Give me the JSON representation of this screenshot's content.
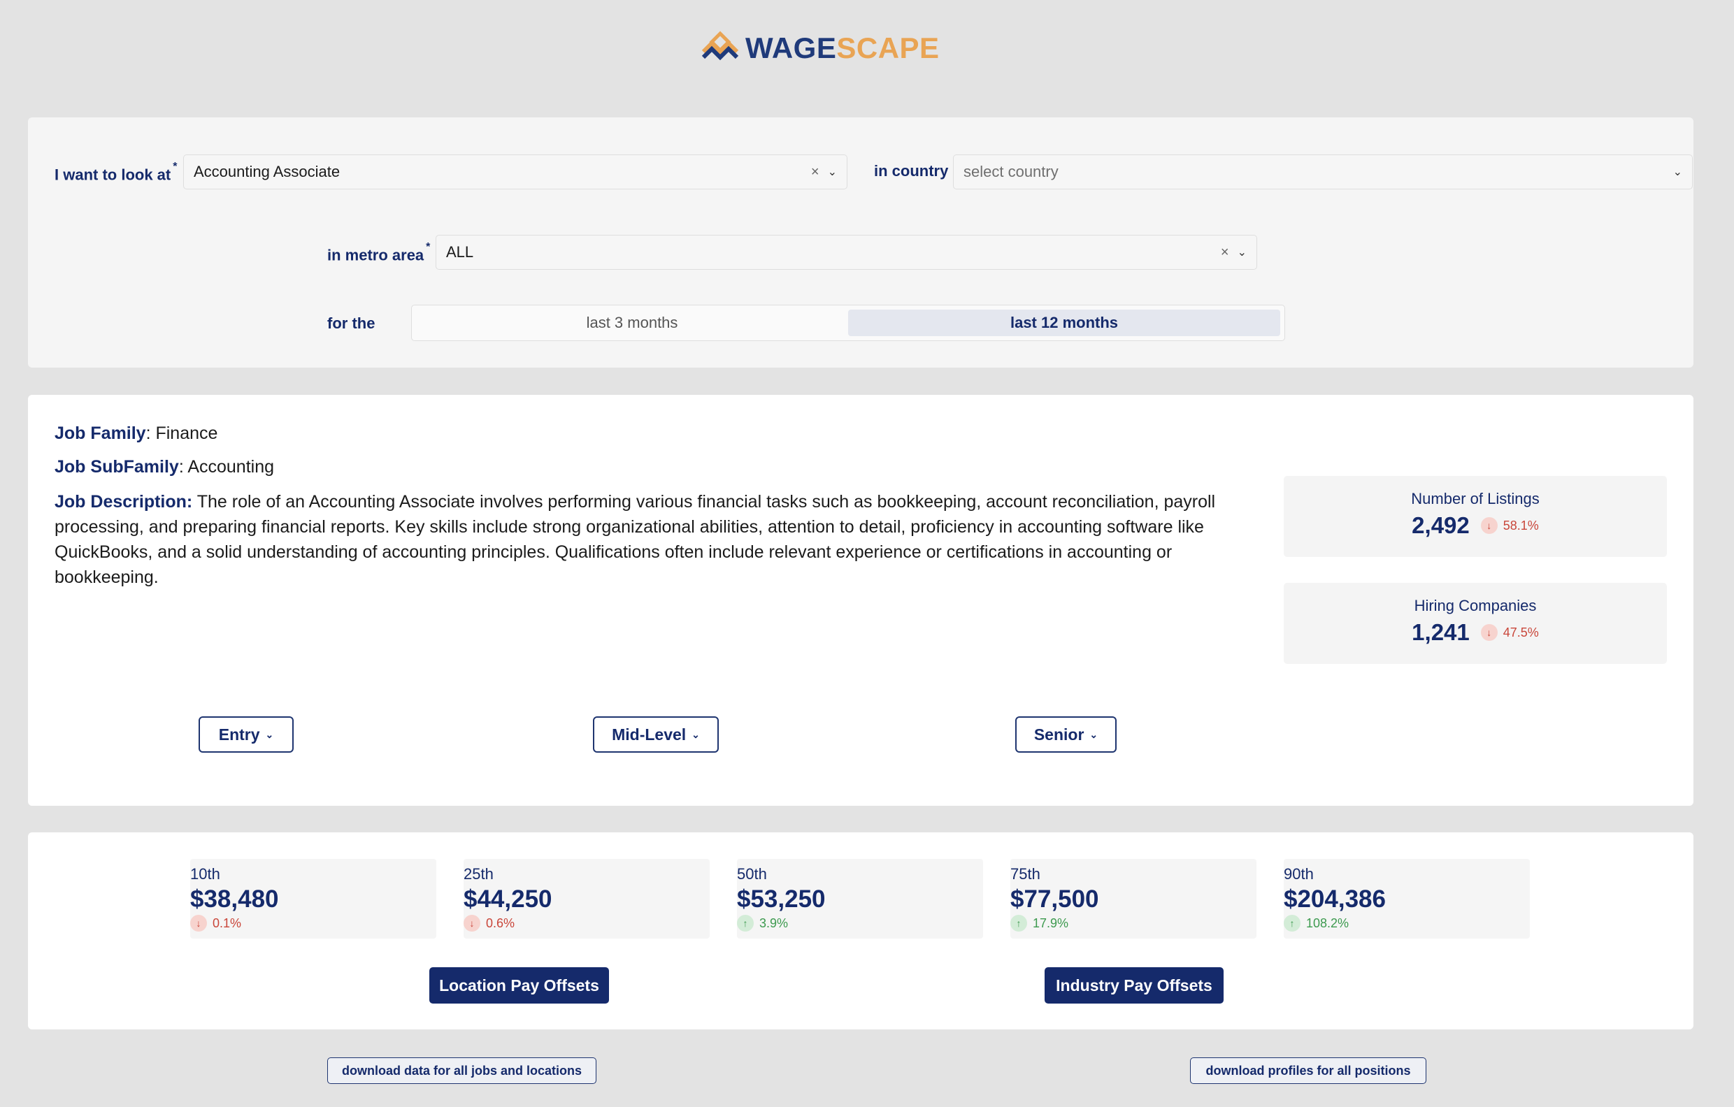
{
  "brand": {
    "name_part1": "WAGE",
    "name_part2": "SCAPE",
    "color_dark": "#1f3a7a",
    "color_accent": "#e9a454"
  },
  "filters": {
    "job_label": "I want to look at",
    "job_value": "Accounting Associate",
    "country_label": "in country",
    "country_placeholder": "select country",
    "metro_label": "in metro area",
    "metro_value": "ALL",
    "period_label": "for the",
    "periods": [
      {
        "label": "last 3 months",
        "active": false
      },
      {
        "label": "last 12 months",
        "active": true
      }
    ],
    "required_mark": "*",
    "clear_icon": "×",
    "dropdown_icon": "chevron-down-icon"
  },
  "job": {
    "family_label": "Job Family",
    "family_value": ": Finance",
    "subfamily_label": "Job SubFamily",
    "subfamily_value": ": Accounting",
    "description_label": "Job Description:",
    "description": "The role of an Accounting Associate involves performing various financial tasks such as bookkeeping, account reconciliation, payroll processing, and preparing financial reports. Key skills include strong organizational abilities, attention to detail, proficiency in accounting software like QuickBooks, and a solid understanding of accounting principles. Qualifications often include relevant experience or certifications in accounting or bookkeeping.",
    "metrics": [
      {
        "label": "Number of Listings",
        "value": "2,492",
        "change": "58.1%",
        "direction": "down"
      },
      {
        "label": "Hiring Companies",
        "value": "1,241",
        "change": "47.5%",
        "direction": "down"
      }
    ],
    "levels": [
      "Entry",
      "Mid-Level",
      "Senior"
    ]
  },
  "pay": {
    "percentiles": [
      {
        "label": "10th",
        "value": "$38,480",
        "change": "0.1%",
        "direction": "down"
      },
      {
        "label": "25th",
        "value": "$44,250",
        "change": "0.6%",
        "direction": "down"
      },
      {
        "label": "50th",
        "value": "$53,250",
        "change": "3.9%",
        "direction": "up"
      },
      {
        "label": "75th",
        "value": "$77,500",
        "change": "17.9%",
        "direction": "up"
      },
      {
        "label": "90th",
        "value": "$204,386",
        "change": "108.2%",
        "direction": "up"
      }
    ],
    "location_button": "Location Pay Offsets",
    "industry_button": "Industry Pay Offsets"
  },
  "downloads": {
    "all_jobs": "download data for all jobs and locations",
    "all_profiles": "download profiles for all positions"
  },
  "colors": {
    "navy": "#152a6b",
    "down": "#c9463a",
    "up": "#3d9a4f"
  }
}
